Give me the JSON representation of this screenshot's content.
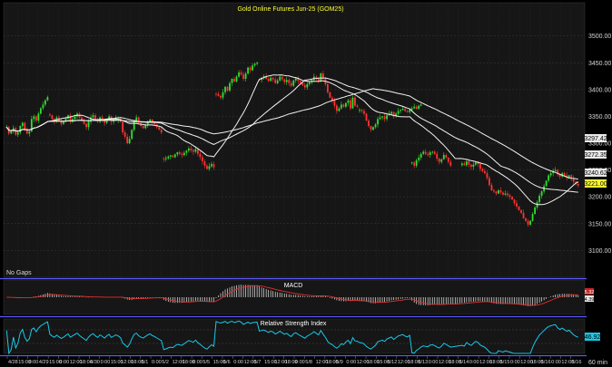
{
  "chart_data": [
    {
      "type": "candlestick",
      "title": "Gold Online Futures Jun-25 (GOM25)",
      "subtitle": "No Gaps",
      "ylim": [
        3060,
        3540
      ],
      "y_ticks": [
        "3500.00",
        "3450.00",
        "3400.00",
        "3350.00",
        "3300.00",
        "3250.00",
        "3200.00",
        "3150.00",
        "3100.00"
      ],
      "y_tick_values": [
        3500,
        3450,
        3400,
        3350,
        3300,
        3250,
        3200,
        3150,
        3100
      ],
      "x_ticks": [
        "4/28",
        "15:00",
        "0:00",
        "4/29",
        "15:00",
        "0:00",
        "12:00",
        "18:00",
        "4/30",
        "0:00",
        "15:00",
        "12:00",
        "18:00",
        "5/1",
        "0:00",
        "5/2",
        "12:00",
        "18:00",
        "0:00",
        "5/5",
        "15:00",
        "5/6",
        "0:00",
        "12:00",
        "5/7",
        "15:00",
        "12:00",
        "18:00",
        "0:00",
        "5/8",
        "12:00",
        "18:00",
        "5/9",
        "0:00",
        "12:00",
        "18:00",
        "15:00",
        "5/12",
        "12:00",
        "18:00",
        "5/13",
        "0:00",
        "12:00",
        "18:00",
        "5/14",
        "0:00",
        "12:00",
        "18:00",
        "5/15",
        "0:00",
        "12:00",
        "18:00",
        "5/16",
        "0:00",
        "12:00",
        "5/16"
      ],
      "x_unit": "60 min",
      "segments": [
        {
          "start": 0,
          "close": [
            3330,
            3318,
            3322,
            3328,
            3316,
            3320,
            3332,
            3338,
            3326,
            3318,
            3322,
            3345,
            3350,
            3342,
            3355,
            3365,
            3372,
            3380,
            3386
          ]
        },
        {
          "start": 19,
          "close": [
            3352,
            3345,
            3340,
            3348,
            3342,
            3336,
            3340,
            3346,
            3352,
            3340,
            3345,
            3350,
            3355,
            3348,
            3342,
            3336,
            3330,
            3340,
            3348,
            3352,
            3345,
            3340,
            3348,
            3344,
            3338,
            3345,
            3350,
            3340,
            3344,
            3348
          ]
        },
        {
          "start": 49,
          "close": [
            3345,
            3340,
            3320,
            3312,
            3300,
            3308,
            3325,
            3342,
            3348,
            3338,
            3332,
            3328,
            3334,
            3340,
            3344,
            3338,
            3335,
            3330,
            3325,
            3320
          ]
        },
        {
          "start": 69,
          "close": [
            3270,
            3272,
            3275,
            3277,
            3274,
            3279,
            3283,
            3280,
            3278,
            3282,
            3286,
            3290,
            3287,
            3284,
            3289,
            3280,
            3274,
            3266,
            3258,
            3252,
            3257,
            3261,
            3255
          ]
        },
        {
          "start": 92,
          "close": [
            3392,
            3388,
            3385,
            3395,
            3405,
            3398,
            3412,
            3420,
            3415,
            3424,
            3432,
            3428,
            3420,
            3430,
            3441,
            3436,
            3445,
            3448,
            3450
          ]
        },
        {
          "start": 111,
          "close": [
            3418,
            3422,
            3425,
            3420,
            3416,
            3422,
            3419,
            3412,
            3417,
            3424,
            3419,
            3414,
            3418,
            3412,
            3407,
            3417,
            3421,
            3416,
            3412,
            3408,
            3404,
            3410,
            3414,
            3418,
            3424,
            3420,
            3416,
            3430,
            3420,
            3410,
            3395,
            3385,
            3380,
            3370,
            3360,
            3365,
            3372,
            3368,
            3375,
            3380,
            3365,
            3385,
            3370,
            3368
          ]
        },
        {
          "start": 155,
          "close": [
            3362,
            3360,
            3355,
            3342,
            3332,
            3325,
            3330,
            3335,
            3345,
            3348,
            3350,
            3345,
            3352,
            3355,
            3358,
            3350,
            3355,
            3360,
            3362,
            3364,
            3360,
            3358,
            3362,
            3365,
            3368,
            3364,
            3370,
            3372
          ]
        },
        {
          "start": 178,
          "close": [
            3264,
            3258,
            3268,
            3273,
            3280,
            3284,
            3280,
            3278,
            3283,
            3284,
            3280,
            3271,
            3265,
            3270,
            3278,
            3273,
            3265,
            3258
          ]
        },
        {
          "start": 200,
          "close": [
            3262,
            3259,
            3266,
            3260,
            3256,
            3260,
            3264,
            3261,
            3252,
            3248,
            3244,
            3235,
            3222,
            3212,
            3210,
            3206,
            3212,
            3208,
            3204,
            3206,
            3203,
            3200,
            3195,
            3188,
            3182,
            3175,
            3170,
            3160,
            3155,
            3148,
            3155,
            3168,
            3180,
            3190,
            3202,
            3210,
            3220,
            3230,
            3240,
            3244,
            3248,
            3250,
            3242,
            3238,
            3244,
            3240,
            3236,
            3240,
            3234,
            3228,
            3224,
            3221
          ]
        }
      ],
      "ma_values": [
        3297.42,
        3272.35,
        3240.62
      ],
      "last_price": 3221.0,
      "ma_label_texts": [
        "3297.42",
        "3272.35",
        "3240.62"
      ],
      "last_price_text": "3221.00"
    },
    {
      "type": "histogram",
      "title": "MACD",
      "ylim": [
        -20,
        16
      ],
      "last_values": [
        "5.32",
        "4.39"
      ]
    },
    {
      "type": "line",
      "title": "Relative Strength Index",
      "ylim": [
        20,
        80
      ],
      "last_value_text": "46.92"
    }
  ]
}
